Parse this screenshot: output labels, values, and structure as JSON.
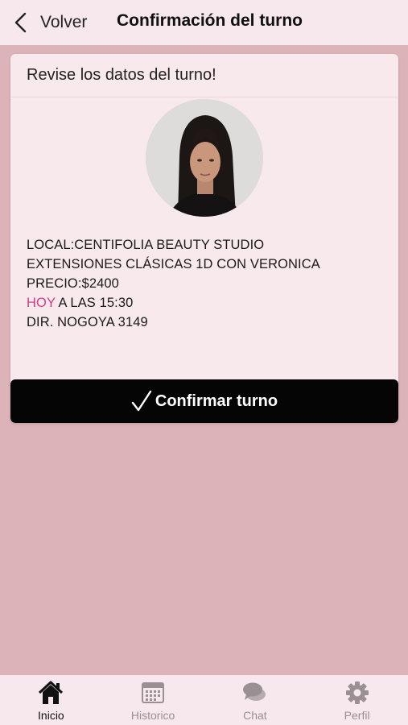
{
  "header": {
    "back_label": "Volver",
    "title": "Confirmación del turno"
  },
  "card": {
    "heading": "Revise los datos del turno!",
    "local": "LOCAL:CENTIFOLIA BEAUTY STUDIO",
    "service": "EXTENSIONES CLÁSICAS 1D CON VERONICA",
    "price": "PRECIO:$2400",
    "day": "HOY",
    "time": " A LAS 15:30",
    "address": "DIR. NOGOYA 3149",
    "confirm_label": "Confirmar turno"
  },
  "tabs": [
    {
      "label": "Inicio",
      "icon": "home-icon",
      "active": true
    },
    {
      "label": "Historico",
      "icon": "calendar-icon",
      "active": false
    },
    {
      "label": "Chat",
      "icon": "chat-icon",
      "active": false
    },
    {
      "label": "Perfil",
      "icon": "gear-icon",
      "active": false
    }
  ],
  "colors": {
    "background": "#dcb3b9",
    "surface": "#f8e9ed",
    "accent": "#d03d87",
    "button": "#050505"
  }
}
